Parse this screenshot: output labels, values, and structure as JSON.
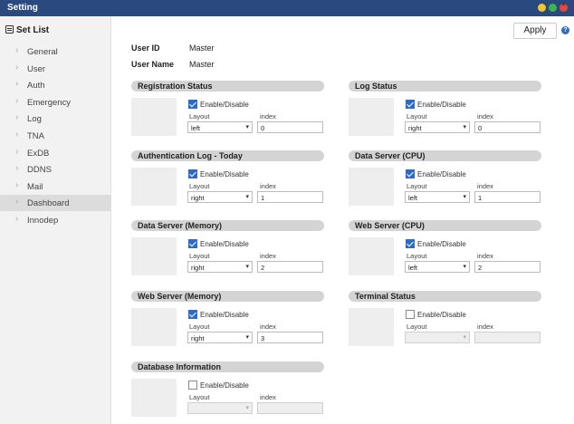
{
  "window": {
    "title": "Setting"
  },
  "sidebar": {
    "heading": "Set List",
    "items": [
      {
        "label": "General"
      },
      {
        "label": "User"
      },
      {
        "label": "Auth"
      },
      {
        "label": "Emergency"
      },
      {
        "label": "Log"
      },
      {
        "label": "TNA"
      },
      {
        "label": "ExDB"
      },
      {
        "label": "DDNS"
      },
      {
        "label": "Mail"
      },
      {
        "label": "Dashboard",
        "active": true
      },
      {
        "label": "Innodep"
      }
    ]
  },
  "toolbar": {
    "apply_label": "Apply",
    "help_glyph": "?"
  },
  "info": {
    "user_id_label": "User ID",
    "user_id_value": "Master",
    "user_name_label": "User Name",
    "user_name_value": "Master"
  },
  "common": {
    "enable_label": "Enable/Disable",
    "layout_label": "Layout",
    "index_label": "index"
  },
  "sections": [
    {
      "title": "Registration Status",
      "enabled": true,
      "layout": "left",
      "index": "0"
    },
    {
      "title": "Log Status",
      "enabled": true,
      "layout": "right",
      "index": "0"
    },
    {
      "title": "Authentication Log - Today",
      "enabled": true,
      "layout": "right",
      "index": "1"
    },
    {
      "title": "Data Server (CPU)",
      "enabled": true,
      "layout": "left",
      "index": "1"
    },
    {
      "title": "Data Server (Memory)",
      "enabled": true,
      "layout": "right",
      "index": "2"
    },
    {
      "title": "Web Server (CPU)",
      "enabled": true,
      "layout": "left",
      "index": "2"
    },
    {
      "title": "Web Server (Memory)",
      "enabled": true,
      "layout": "right",
      "index": "3"
    },
    {
      "title": "Terminal Status",
      "enabled": false,
      "layout": "",
      "index": ""
    },
    {
      "title": "Database Information",
      "enabled": false,
      "layout": "",
      "index": ""
    }
  ],
  "colors": {
    "titlebar": "#2a4a7f",
    "checkbox_on": "#2d6bc5",
    "section_header": "#d4d4d4",
    "sidebar_active": "#dcdcdc"
  }
}
